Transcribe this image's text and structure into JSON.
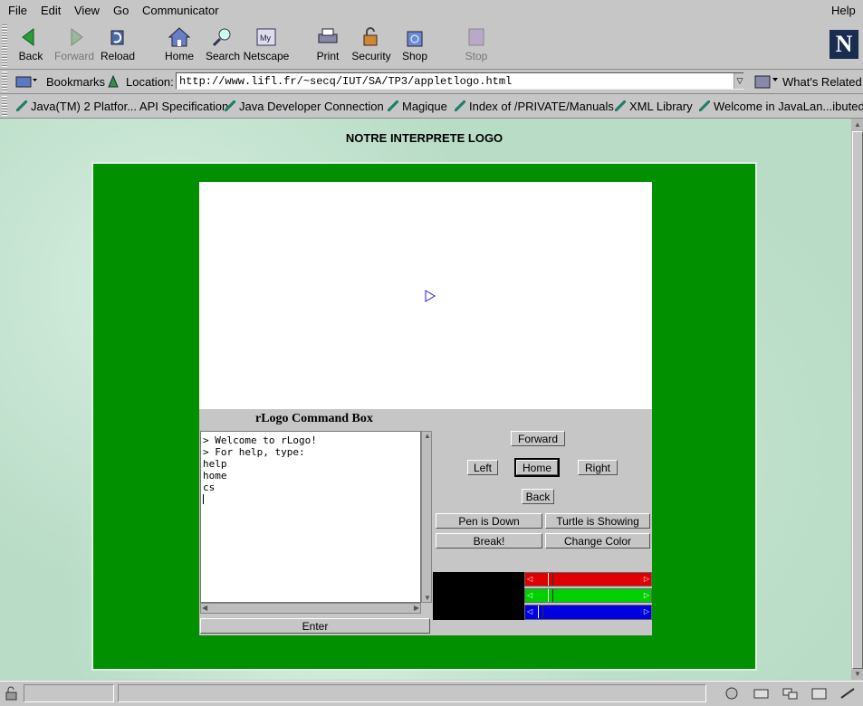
{
  "menu": {
    "file": "File",
    "edit": "Edit",
    "view": "View",
    "go": "Go",
    "communicator": "Communicator",
    "help": "Help"
  },
  "toolbar": {
    "back": "Back",
    "forward": "Forward",
    "reload": "Reload",
    "home": "Home",
    "search": "Search",
    "netscape": "Netscape",
    "print": "Print",
    "security": "Security",
    "shop": "Shop",
    "stop": "Stop"
  },
  "location": {
    "bookmarks": "Bookmarks",
    "label": "Location:",
    "url": "http://www.lifl.fr/~secq/IUT/SA/TP3/appletlogo.html",
    "related": "What's Related"
  },
  "personal_toolbar": [
    "Java(TM) 2 Platfor... API Specification",
    "Java Developer Connection",
    "Magique",
    "Index of /PRIVATE/Manuals",
    "XML Library",
    "Welcome in JavaLan...ibuted"
  ],
  "page": {
    "title": "NOTRE INTERPRETE LOGO",
    "command_box_title": "rLogo Command Box",
    "console_lines": [
      "> Welcome to rLogo!",
      "> For help, type:",
      "help",
      "home",
      "cs"
    ],
    "buttons": {
      "forward": "Forward",
      "left": "Left",
      "home": "Home",
      "right": "Right",
      "back": "Back",
      "pen": "Pen is Down",
      "turtle": "Turtle is Showing",
      "break": "Break!",
      "color": "Change Color",
      "enter": "Enter"
    },
    "color_sliders": {
      "red": 0.1,
      "green": 0.1,
      "blue": 0.0
    }
  },
  "colors": {
    "applet_bg": "#009000",
    "red": "#e00000",
    "green": "#00d000",
    "blue": "#0000e0"
  }
}
